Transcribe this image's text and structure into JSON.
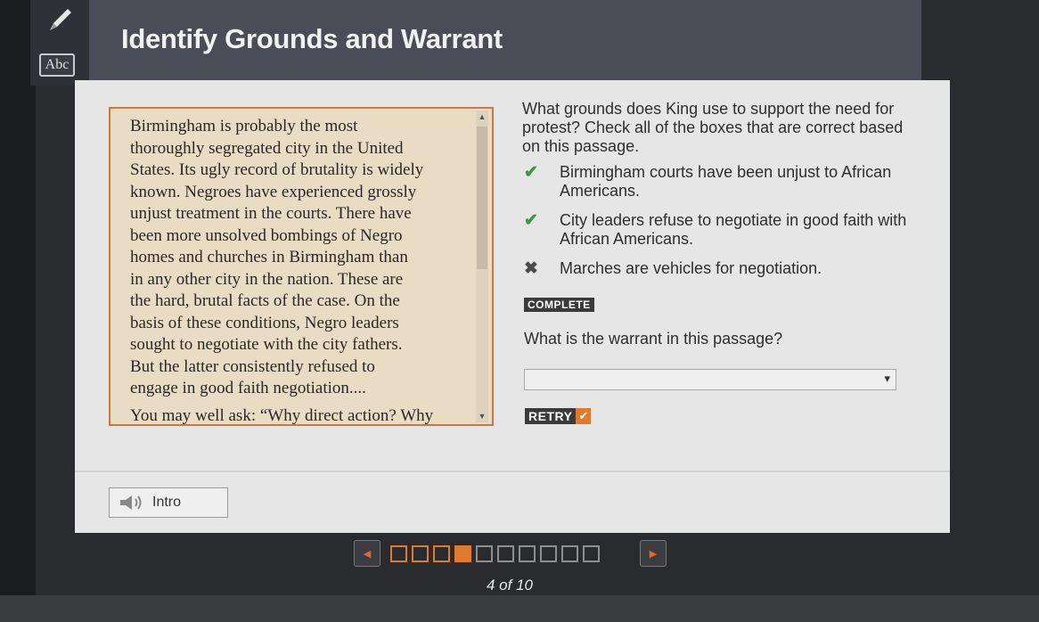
{
  "title": "Identify Grounds and Warrant",
  "toolbar": {
    "pencil_icon": "pencil-icon",
    "abc_icon_text": "Abc"
  },
  "passage": {
    "lines": [
      "Birmingham is probably the most",
      "thoroughly segregated city in the United",
      "States. Its ugly record of brutality is widely",
      "known. Negroes have experienced grossly",
      "unjust treatment in the courts. There have",
      "been more unsolved bombings of Negro",
      "homes and churches in Birmingham than",
      "in any other city in the nation. These are",
      "the hard, brutal facts of the case. On the",
      "basis of these conditions, Negro leaders",
      "sought to negotiate with the city fathers.",
      "But the latter consistently refused to",
      "engage in good faith negotiation....",
      "You may well ask: “Why direct action? Why"
    ]
  },
  "question1": {
    "text": "What grounds does King use to support the need for protest? Check all of the boxes that are correct based on this passage.",
    "choices": [
      {
        "mark": "✔",
        "status": "correct",
        "label": "Birmingham courts have been unjust to African Americans."
      },
      {
        "mark": "✔",
        "status": "correct",
        "label": "City leaders refuse to negotiate in good faith with African Americans."
      },
      {
        "mark": "✖",
        "status": "incorrect",
        "label": "Marches are vehicles for negotiation."
      }
    ],
    "status_badge": "COMPLETE"
  },
  "question2": {
    "text": "What is the warrant in this passage?",
    "select_value": "",
    "retry_label": "RETRY"
  },
  "intro_label": "Intro",
  "pager": {
    "counter": "4 of 10",
    "total": 10,
    "current": 4
  },
  "colors": {
    "accent": "#e07a2e",
    "correct": "#3a9a3a"
  }
}
